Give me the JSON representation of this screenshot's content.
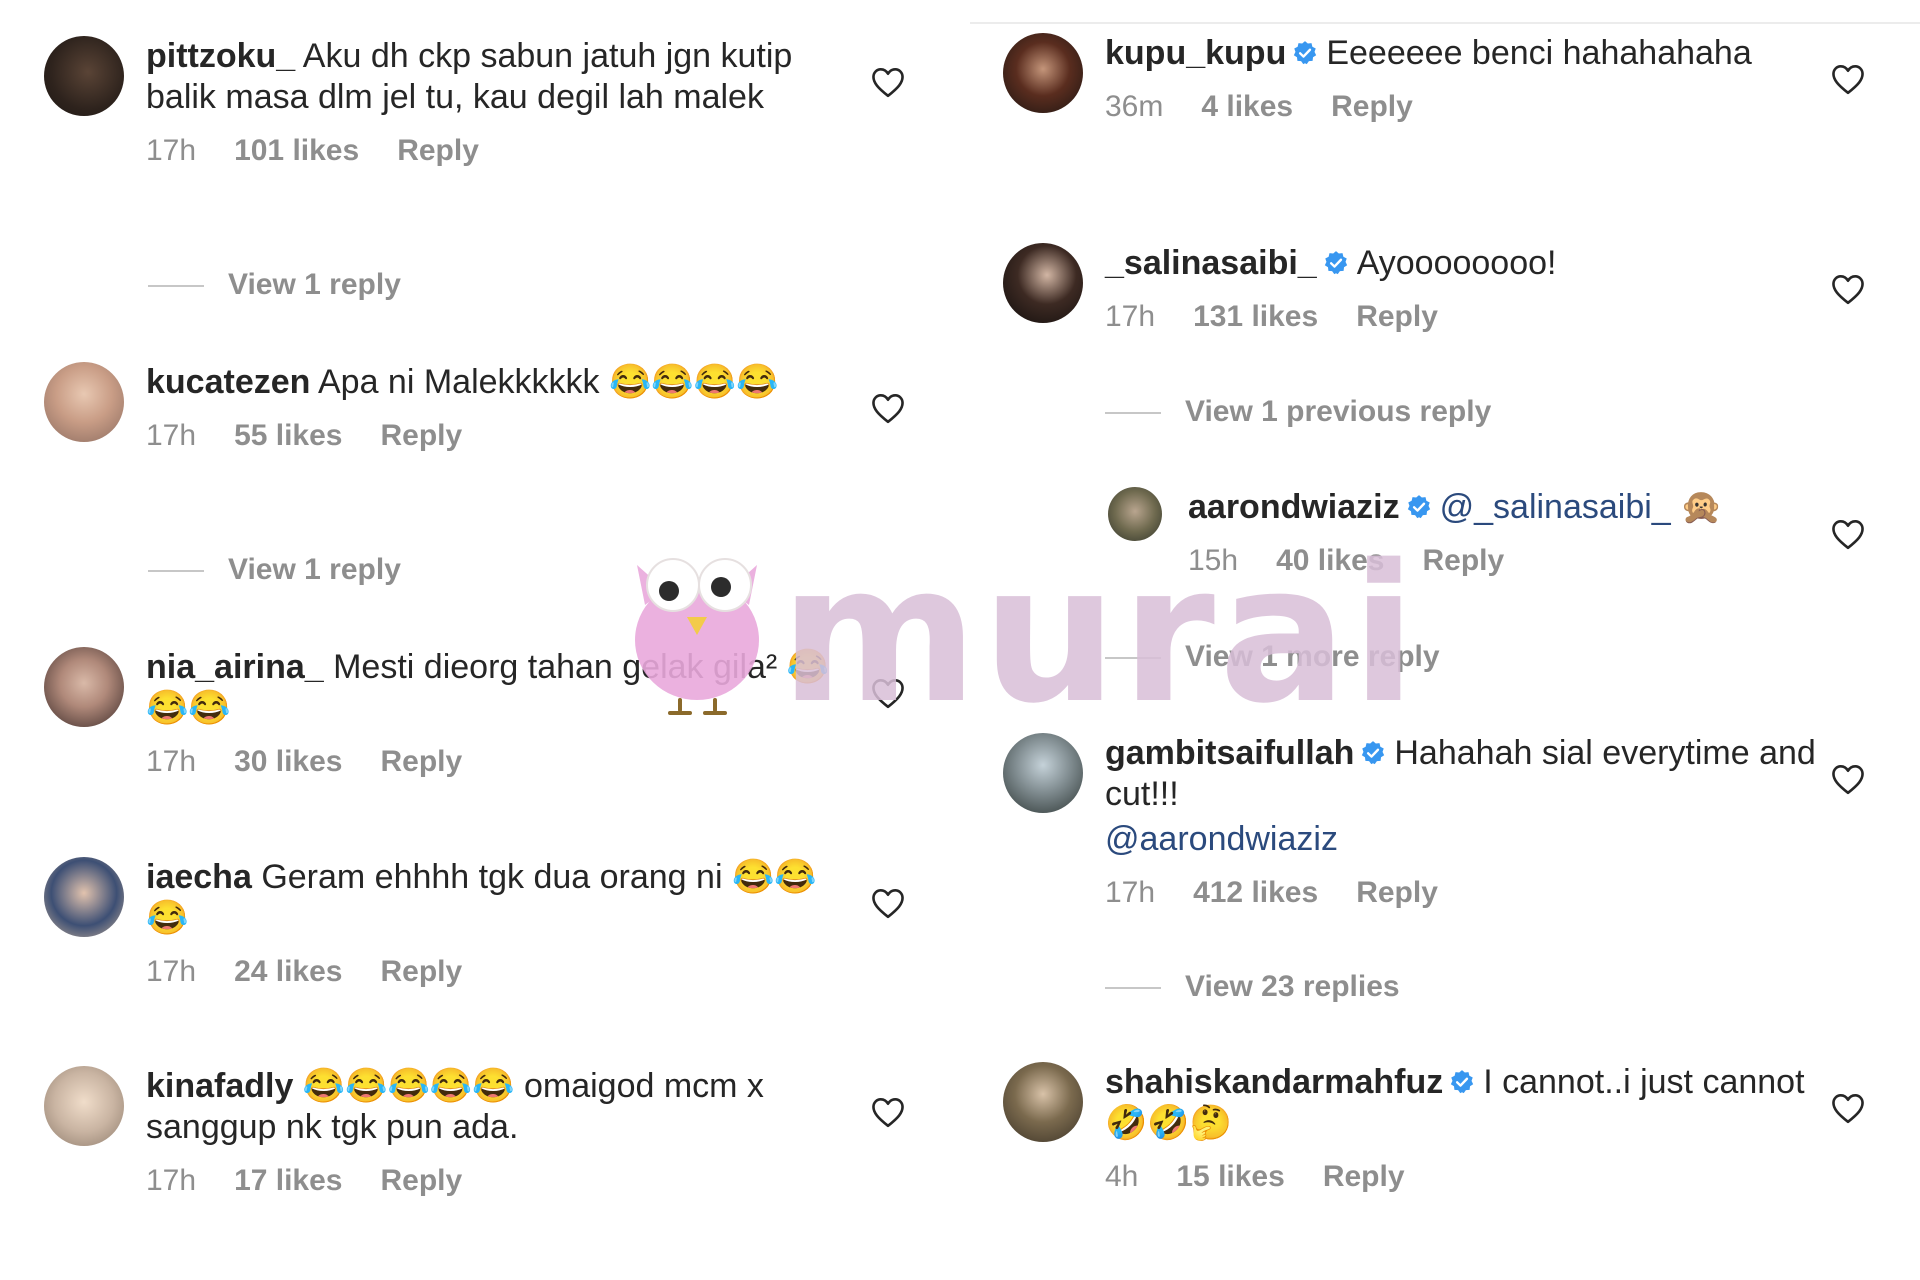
{
  "left_column": {
    "comments": [
      {
        "username": "pittzoku_",
        "verified": false,
        "text": "Aku dh ckp sabun jatuh jgn kutip balik masa dlm jel tu, kau degil lah malek",
        "time": "17h",
        "likes": "101 likes",
        "reply": "Reply",
        "view_replies": "View 1 reply"
      },
      {
        "username": "kucatezen",
        "verified": false,
        "text": "Apa ni Malekkkkkk 😂😂😂😂",
        "time": "17h",
        "likes": "55 likes",
        "reply": "Reply",
        "view_replies": "View 1 reply"
      },
      {
        "username": "nia_airina_",
        "verified": false,
        "text": "Mesti dieorg tahan gelak gila² 😂😂😂",
        "time": "17h",
        "likes": "30 likes",
        "reply": "Reply"
      },
      {
        "username": "iaecha",
        "verified": false,
        "text": "Geram ehhhh tgk dua orang ni 😂😂😂",
        "time": "17h",
        "likes": "24 likes",
        "reply": "Reply"
      },
      {
        "username": "kinafadly",
        "verified": false,
        "text": "😂😂😂😂😂 omaigod mcm x sanggup nk tgk pun ada.",
        "time": "17h",
        "likes": "17 likes",
        "reply": "Reply"
      }
    ]
  },
  "right_column": {
    "comments": [
      {
        "username": "kupu_kupu",
        "verified": true,
        "text": "Eeeeeee benci hahahahaha",
        "time": "36m",
        "likes": "4 likes",
        "reply": "Reply"
      },
      {
        "username": "_salinasaibi_",
        "verified": true,
        "text": "Ayoooooooo!",
        "time": "17h",
        "likes": "131 likes",
        "reply": "Reply",
        "view_replies": "View 1 previous reply"
      },
      {
        "username": "aarondwiaziz",
        "verified": true,
        "mention": "@_salinasaibi_",
        "text": "🙊",
        "time": "15h",
        "likes": "40 likes",
        "reply": "Reply",
        "view_replies": "View 1 more reply"
      },
      {
        "username": "gambitsaifullah",
        "verified": true,
        "text": "Hahahah sial everytime and cut!!!",
        "mention": "@aarondwiaziz",
        "time": "17h",
        "likes": "412 likes",
        "reply": "Reply",
        "view_replies": "View 23 replies"
      },
      {
        "username": "shahiskandarmahfuz",
        "verified": true,
        "text": "I cannot..i just cannot🤣🤣🤔",
        "time": "4h",
        "likes": "15 likes",
        "reply": "Reply"
      }
    ]
  },
  "watermark": {
    "text": "murai"
  },
  "colors": {
    "verified": "#3897f0",
    "meta": "#8e8e8e",
    "text": "#262626",
    "watermark": "#d9bfd8"
  },
  "icons": {
    "like": "heart-outline-icon",
    "verified": "verified-badge-icon"
  }
}
